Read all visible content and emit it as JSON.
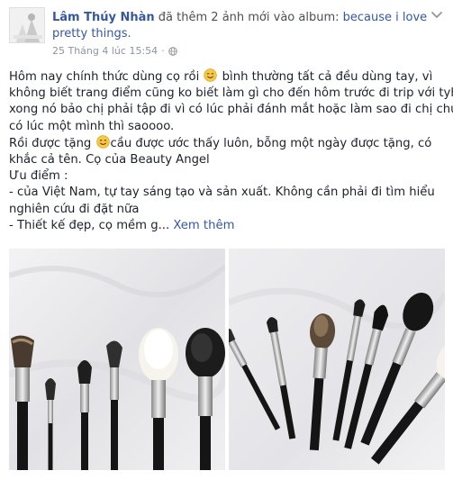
{
  "header": {
    "author": "Lâm Thúy Nhàn",
    "action_text": " đã thêm 2 ảnh mới vào album: ",
    "album": "because i love pretty things.",
    "timestamp": "25 Tháng 4 lúc 15:54",
    "separator": "·"
  },
  "post": {
    "lines": [
      [
        "Hôm nay chính thức dùng cọ rồi ",
        "emoji",
        " bình thường tất cả đều dùng tay, vì"
      ],
      [
        "không biết trang điểm cũng ko biết làm gì cho đến hôm trước đi trip với tyhd"
      ],
      [
        "xong nó bảo chị phải tập đi vì có lúc phải đánh mắt hoặc làm sao đi chị chứ"
      ],
      [
        "có lúc một mình thì saoooo."
      ],
      [
        "Rồi được tặng ",
        "emoji",
        "cầu được ước thấy luôn, bỗng một ngày được tặng, có"
      ],
      [
        "khắc cả tên. Cọ của Beauty Angel"
      ],
      [
        "Ưu điểm :"
      ],
      [
        "- của Việt Nam, tự tay sáng tạo và sản xuất. Không cần phải đi tìm hiểu"
      ],
      [
        "nghiên cứu đi đặt nữa"
      ],
      [
        "- Thiết kế đẹp, cọ mềm g... "
      ]
    ],
    "see_more": "Xem thêm"
  },
  "icons": {
    "emoji": "smiling-face-icon",
    "privacy": "globe-icon",
    "options": "chevron-down-icon"
  },
  "colors": {
    "link": "#365899",
    "meta": "#90949c",
    "text": "#1d2129"
  }
}
